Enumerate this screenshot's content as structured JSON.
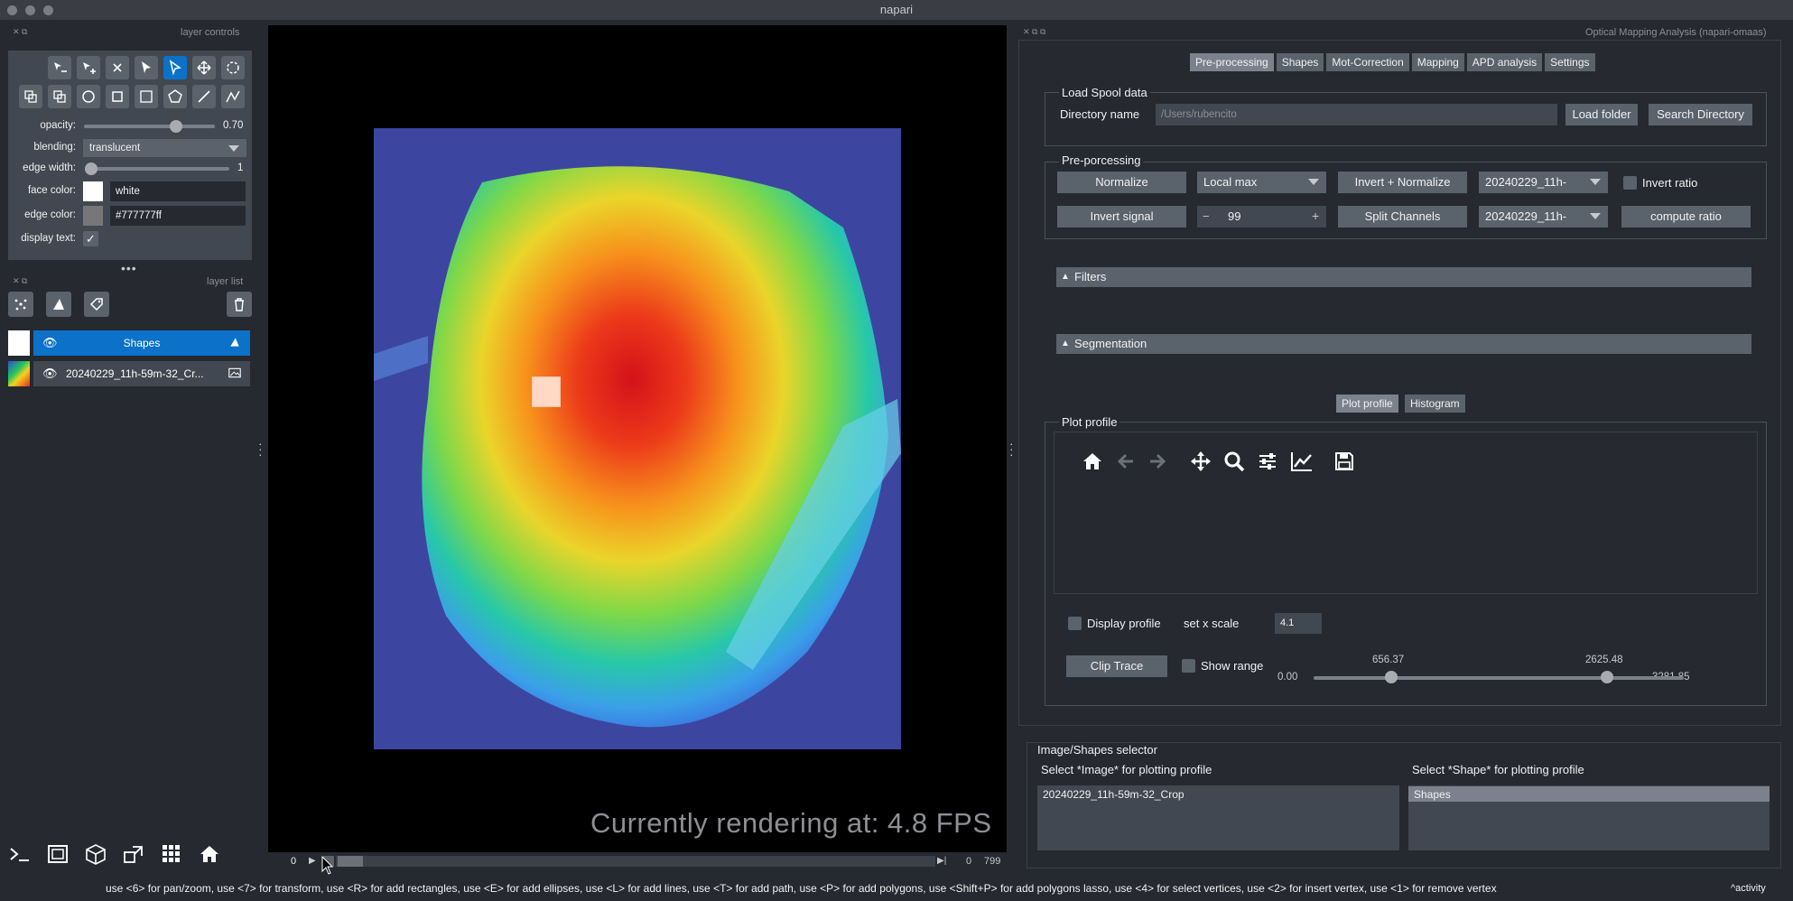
{
  "app": {
    "title": "napari"
  },
  "layer_controls": {
    "header": "layer controls",
    "opacity_label": "opacity:",
    "opacity_value": "0.70",
    "blending_label": "blending:",
    "blending_value": "translucent",
    "edge_width_label": "edge width:",
    "edge_width_value": "1",
    "face_color_label": "face color:",
    "face_color_value": "white",
    "edge_color_label": "edge color:",
    "edge_color_value": "#777777ff",
    "display_text_label": "display text:",
    "opacity_fraction": 0.7
  },
  "layer_list": {
    "header": "layer list",
    "layers": [
      {
        "name": "Shapes",
        "selected": true
      },
      {
        "name": "20240229_11h-59m-32_Cr...",
        "selected": false
      }
    ]
  },
  "viewer": {
    "fps_text": "Currently rendering at: 4.8 FPS",
    "slider_start": "0",
    "slider_current": "0",
    "slider_max": "799"
  },
  "plugin": {
    "title": "Optical Mapping Analysis (napari-omaas)",
    "tabs": [
      "Pre-processing",
      "Shapes",
      "Mot-Correction",
      "Mapping",
      "APD analysis",
      "Settings"
    ],
    "load_group": {
      "title": "Load Spool data",
      "dir_label": "Directory name",
      "dir_placeholder": "/Users/rubencito",
      "load_btn": "Load folder",
      "search_btn": "Search Directory"
    },
    "preproc_group": {
      "title": "Pre-porcessing",
      "normalize_btn": "Normalize",
      "local_max": "Local max",
      "invert_normalize_btn": "Invert + Normalize",
      "combo1": "20240229_11h-",
      "invert_ratio_label": "Invert ratio",
      "invert_signal_btn": "Invert signal",
      "spin_minus": "−",
      "spin_value": "99",
      "spin_plus": "+",
      "split_channels_btn": "Split Channels",
      "combo2": "20240229_11h-",
      "compute_ratio_btn": "compute ratio"
    },
    "filters_label": "Filters",
    "segmentation_label": "Segmentation",
    "plot_tabs": [
      "Plot profile",
      "Histogram"
    ],
    "plot_group": {
      "title": "Plot profile",
      "display_profile": "Display profile",
      "xscale_label": "set x scale",
      "xscale_value": "4.1",
      "clip_btn": "Clip Trace",
      "show_range": "Show range",
      "range_min": "0.00",
      "range_low": "656.37",
      "range_high": "2625.48",
      "range_max": "3281.85"
    },
    "selector": {
      "title": "Image/Shapes selector",
      "image_label": "Select *Image* for plotting profile",
      "shape_label": "Select *Shape* for plotting profile",
      "image_item": "20240229_11h-59m-32_Crop",
      "shape_item": "Shapes"
    }
  },
  "status_bar": {
    "text": "use <6> for pan/zoom, use <7> for transform, use <R> for add rectangles, use <E> for add ellipses, use <L> for add lines, use <T> for add path, use <P> for add polygons, use <Shift+P> for add polygons lasso, use <4> for select vertices, use <2> for insert vertex, use <1> for remove vertex",
    "activity": "activity"
  }
}
